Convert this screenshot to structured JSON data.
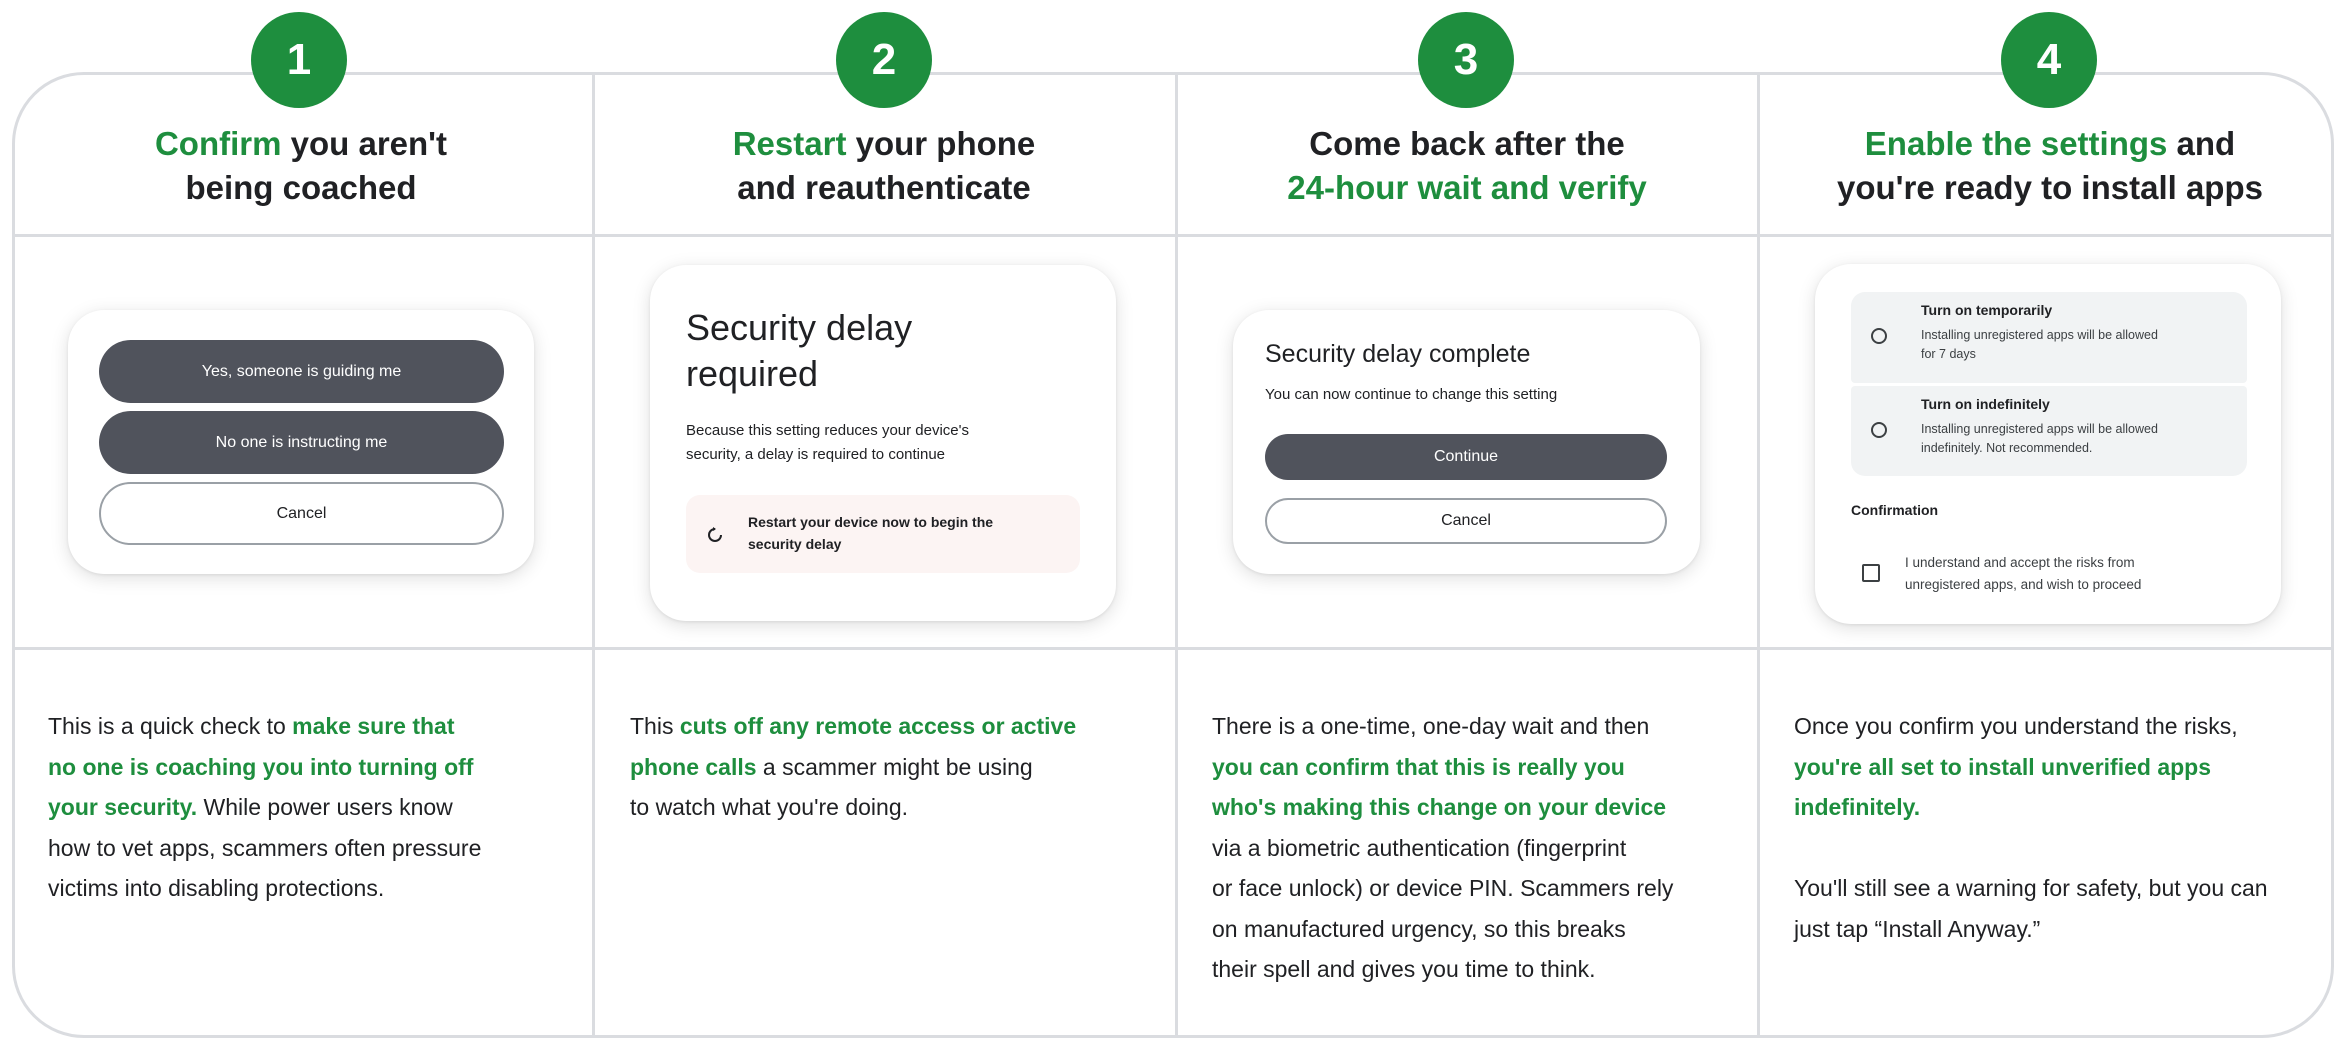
{
  "colors": {
    "accent": "#1e8e3e",
    "dark_button": "#50535c",
    "divider": "#dadce0"
  },
  "steps": [
    {
      "number": "1",
      "title": {
        "green": "Confirm",
        "rest1": " you aren't",
        "line2": "being coached"
      },
      "card": {
        "buttons": [
          "Yes, someone is guiding me",
          "No one is instructing me",
          "Cancel"
        ]
      },
      "desc": {
        "p1": "This is a quick check to ",
        "hl1": "make sure that",
        "hl2": "no one is coaching you into turning off",
        "hl3": "your security.",
        "p2": " While power users know",
        "p3": "how to vet apps, scammers often pressure",
        "p4": "victims into disabling protections."
      }
    },
    {
      "number": "2",
      "title": {
        "green": "Restart",
        "rest1": " your phone",
        "line2": "and reauthenticate"
      },
      "card": {
        "heading_line1": "Security delay",
        "heading_line2": "required",
        "body_line1": "Because this setting reduces your device's",
        "body_line2": "security, a delay is required to continue",
        "notice_line1": "Restart your device now to begin the",
        "notice_line2": "security delay",
        "notice_icon": "restart-icon"
      },
      "desc": {
        "p1": "This ",
        "hl1": "cuts off any remote access or active",
        "hl2": "phone calls",
        "p2": " a scammer might be using",
        "p3": "to watch what you're doing."
      }
    },
    {
      "number": "3",
      "title": {
        "line1": "Come back after the",
        "green_line2": "24-hour wait and verify"
      },
      "card": {
        "heading": "Security delay complete",
        "body": "You can now continue to change this setting",
        "continue_label": "Continue",
        "cancel_label": "Cancel"
      },
      "desc": {
        "p1": "There is a one-time, one-day wait and then",
        "hl1": "you can confirm that this is really you",
        "hl2": "who's making this change on your device",
        "p2": "via a biometric authentication (fingerprint",
        "p3": "or face unlock) or device PIN. Scammers rely",
        "p4": "on manufactured urgency, so this breaks",
        "p5": "their spell and gives you time to think."
      }
    },
    {
      "number": "4",
      "title": {
        "green": "Enable the settings",
        "rest1": " and",
        "line2": "you're ready to install apps"
      },
      "card": {
        "option1_title": "Turn on temporarily",
        "option1_line1": "Installing unregistered apps will be allowed",
        "option1_line2": "for 7 days",
        "option2_title": "Turn on indefinitely",
        "option2_line1": "Installing unregistered apps will be allowed",
        "option2_line2": "indefinitely. Not recommended.",
        "confirmation_label": "Confirmation",
        "checkbox_line1": "I understand and accept the risks from",
        "checkbox_line2": "unregistered apps, and wish to proceed"
      },
      "desc": {
        "p1": "Once you confirm you understand the risks,",
        "hl1": "you're all set to install unverified apps",
        "hl2": "indefinitely.",
        "p2": "You'll still see a warning for safety, but you can",
        "p3": "just tap “Install Anyway.”"
      }
    }
  ]
}
